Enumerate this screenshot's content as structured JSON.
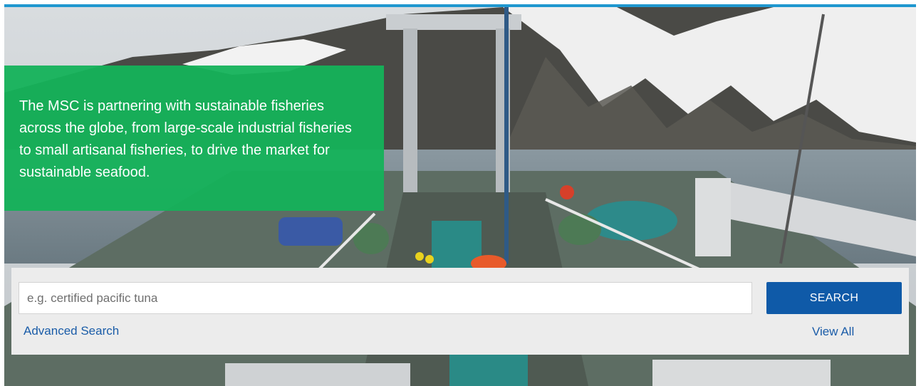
{
  "hero": {
    "image": "fishing-trawler-deck-arctic-mountains",
    "colors": {
      "accent_bar": "#1f97cf",
      "promo_bg": "#14b25a"
    }
  },
  "promo": {
    "line1": "The MSC is partnering with sustainable fisheries",
    "line2": "across the globe, from large-scale industrial fisheries",
    "line3": "to small artisanal fisheries, to drive the market for",
    "line4": "sustainable seafood."
  },
  "search": {
    "placeholder": "e.g. certified pacific tuna",
    "value": "",
    "button_label": "SEARCH",
    "advanced_link": "Advanced Search",
    "view_all_link": "View All",
    "colors": {
      "button_bg": "#0f5aa8",
      "link": "#1a5ca8",
      "panel_bg": "#ececec"
    }
  }
}
